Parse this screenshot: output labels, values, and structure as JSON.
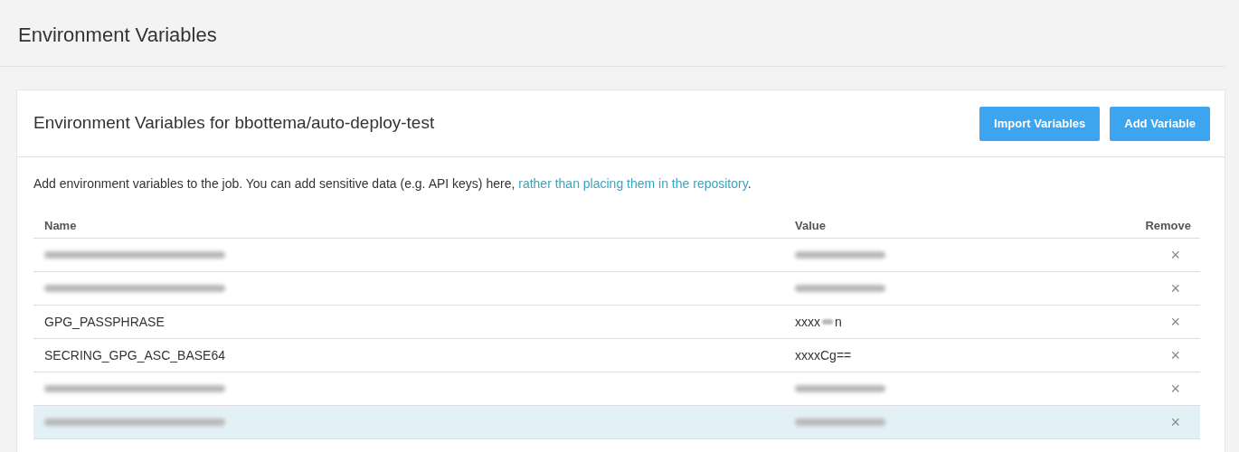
{
  "page_title": "Environment Variables",
  "card": {
    "title": "Environment Variables for bbottema/auto-deploy-test",
    "buttons": [
      "Import Variables",
      "Add Variable"
    ],
    "description": {
      "text": "Add environment variables to the job. You can add sensitive data (e.g. API keys) here, ",
      "link": "rather than placing them in the repository",
      "end": "."
    },
    "table": {
      "columns": [
        "Name",
        "Value",
        "Remove"
      ],
      "rows": [
        {
          "name": [
            {
              "kind": "blur"
            }
          ],
          "value": [
            {
              "kind": "blur"
            }
          ],
          "remove": "×",
          "hovered": false
        },
        {
          "name": [
            {
              "kind": "blur"
            }
          ],
          "value": [
            {
              "kind": "blur"
            }
          ],
          "remove": "×",
          "hovered": false
        },
        {
          "name": [
            {
              "kind": "text",
              "text": "GPG_PASSPHRASE"
            }
          ],
          "value": [
            {
              "kind": "text",
              "text": "xxxx"
            },
            {
              "kind": "blur-small"
            },
            {
              "kind": "text",
              "text": "n"
            }
          ],
          "remove": "×",
          "hovered": false
        },
        {
          "name": [
            {
              "kind": "text",
              "text": "SECRING_GPG_ASC_BASE64"
            }
          ],
          "value": [
            {
              "kind": "text",
              "text": "xxxxCg=="
            }
          ],
          "remove": "×",
          "hovered": false
        },
        {
          "name": [
            {
              "kind": "blur"
            }
          ],
          "value": [
            {
              "kind": "blur"
            }
          ],
          "remove": "×",
          "hovered": false
        },
        {
          "name": [
            {
              "kind": "blur"
            }
          ],
          "value": [
            {
              "kind": "blur"
            }
          ],
          "remove": "×",
          "hovered": true
        }
      ]
    }
  }
}
